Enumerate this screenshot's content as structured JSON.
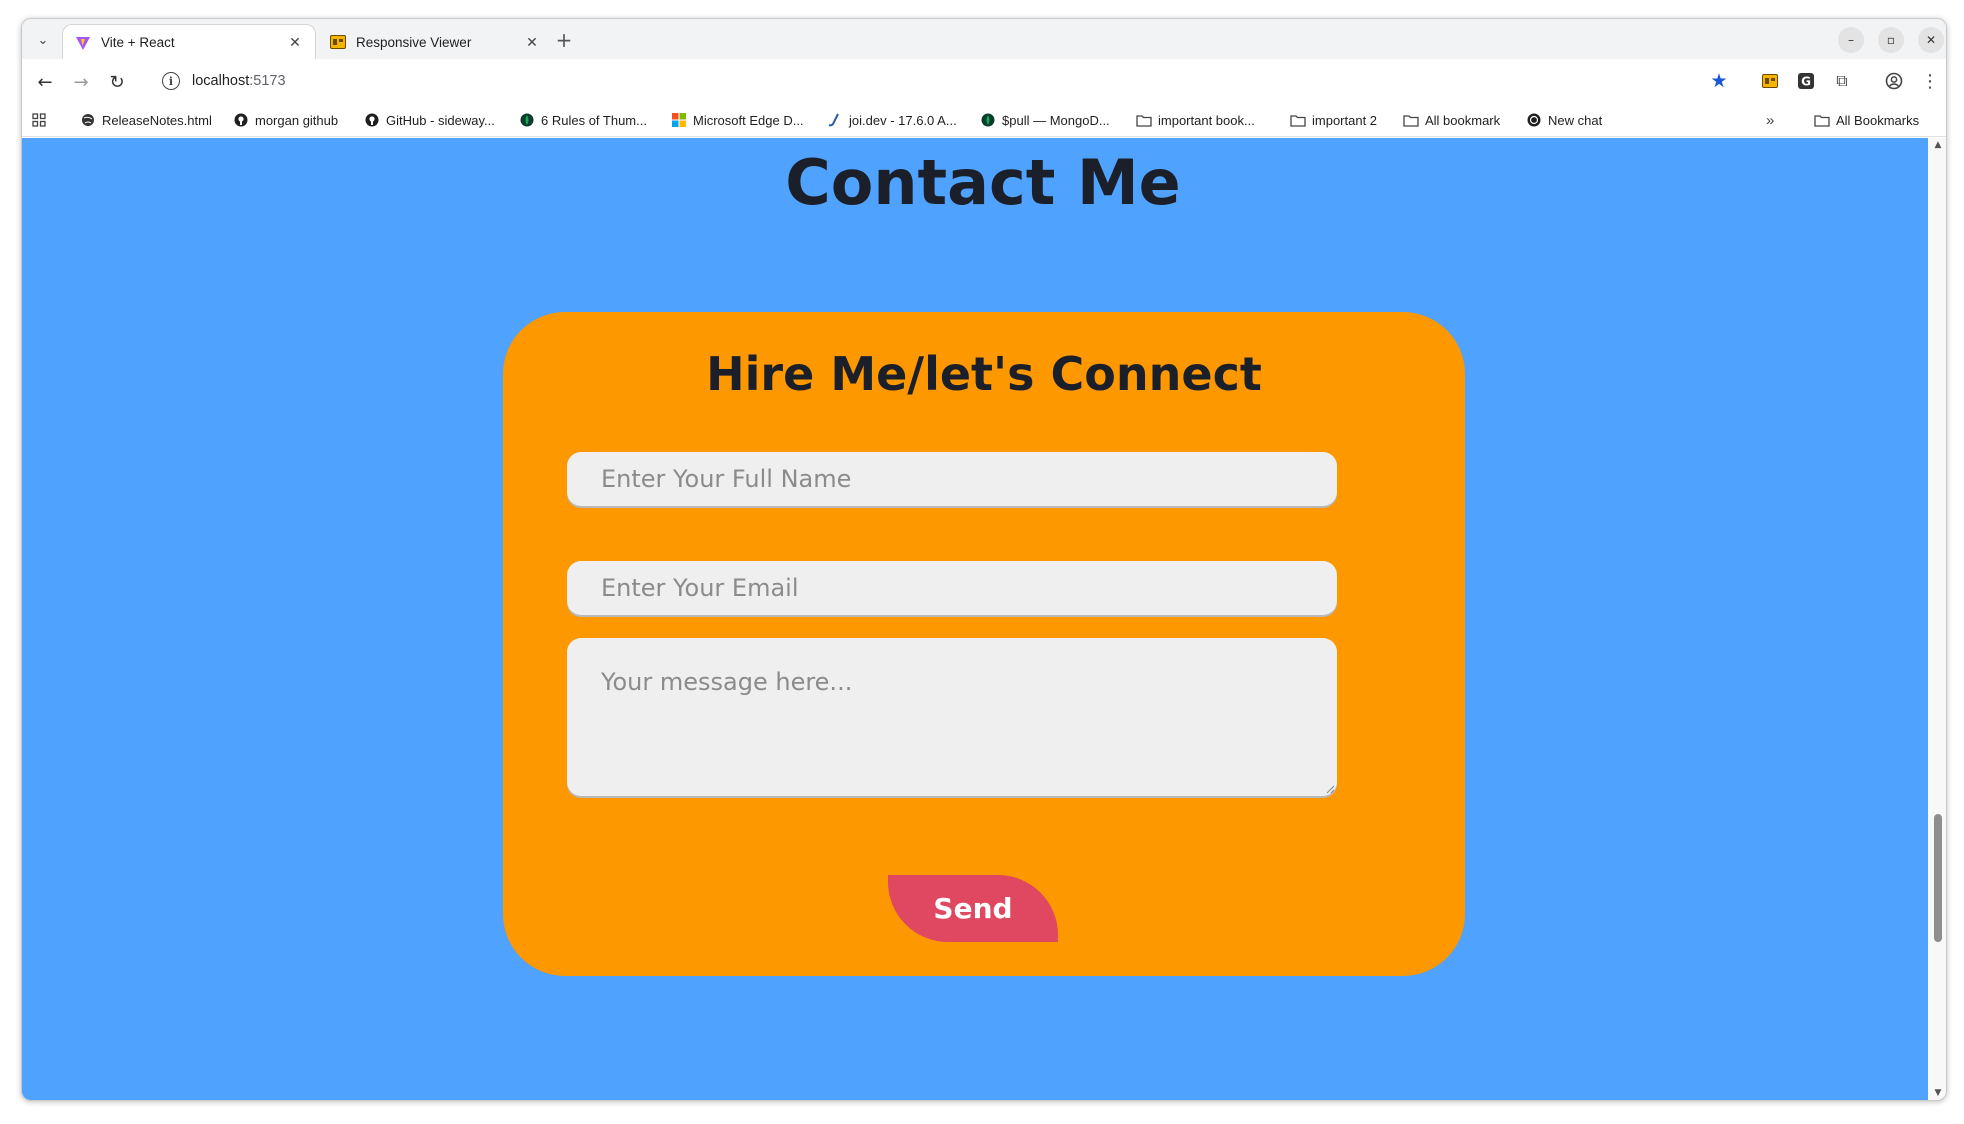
{
  "browser": {
    "tabs": [
      {
        "title": "Vite + React",
        "active": true,
        "favicon": "vite-logo-icon"
      },
      {
        "title": "Responsive Viewer",
        "active": false,
        "favicon": "responsive-viewer-icon"
      }
    ],
    "address": {
      "host": "localhost",
      "port": ":5173"
    },
    "bookmarks": [
      {
        "label": "ReleaseNotes.html",
        "icon": "globe-icon"
      },
      {
        "label": "morgan github",
        "icon": "github-icon"
      },
      {
        "label": "GitHub - sideway...",
        "icon": "github-icon"
      },
      {
        "label": "6 Rules of Thum...",
        "icon": "mongodb-leaf-icon"
      },
      {
        "label": "Microsoft Edge D...",
        "icon": "microsoft-icon"
      },
      {
        "label": "joi.dev - 17.6.0 A...",
        "icon": "joi-icon"
      },
      {
        "label": "$pull — MongoD...",
        "icon": "mongodb-leaf-icon"
      },
      {
        "label": "important book...",
        "icon": "folder-icon"
      },
      {
        "label": "important 2",
        "icon": "folder-icon"
      },
      {
        "label": "All bookmark",
        "icon": "folder-icon"
      },
      {
        "label": "New chat",
        "icon": "openai-icon"
      }
    ],
    "all_bookmarks": "All Bookmarks"
  },
  "page": {
    "title": "Contact Me",
    "background": "#4fa2fd",
    "card": {
      "title": "Hire Me/let's Connect",
      "background": "#fd9800",
      "name_placeholder": "Enter Your Full Name",
      "email_placeholder": "Enter Your Email",
      "message_placeholder": "Your message here...",
      "send_label": "Send",
      "send_color": "#df4860"
    }
  }
}
